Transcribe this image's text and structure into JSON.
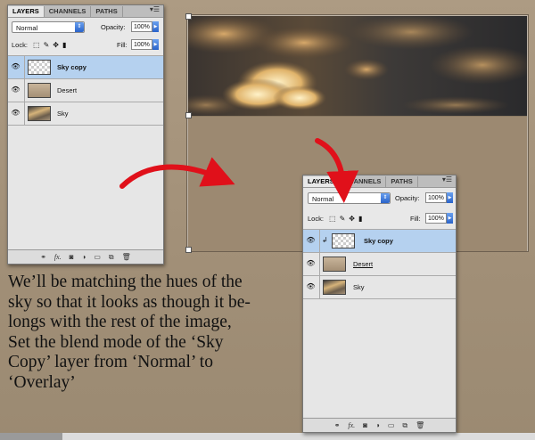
{
  "panel_tabs": [
    "LAYERS",
    "CHANNELS",
    "PATHS"
  ],
  "blend_mode": "Normal",
  "opacity_label": "Opacity:",
  "opacity_value": "100%",
  "lock_label": "Lock:",
  "fill_label": "Fill:",
  "fill_value": "100%",
  "layers": [
    {
      "name": "Sky copy",
      "selected": true
    },
    {
      "name": "Desert",
      "selected": false
    },
    {
      "name": "Sky",
      "selected": false
    }
  ],
  "panel_menu_icon": "panel-menu-icon",
  "footer_icons": [
    "link-icon",
    "fx-icon",
    "mask-icon",
    "adjustment-icon",
    "group-icon",
    "new-layer-icon",
    "trash-icon"
  ],
  "caption_lines": [
    "We’ll be matching the hues of the",
    "sky so that it looks as though it be-",
    "longs with the rest of the image,",
    "Set the blend mode of the ‘Sky",
    "Copy’ layer from ‘Normal’ to",
    "‘Overlay’"
  ],
  "colors": {
    "background": "#a3917a",
    "selection": "#b5d1ef",
    "arrow": "#e0101a",
    "accent_blue": "#2a63c9"
  }
}
